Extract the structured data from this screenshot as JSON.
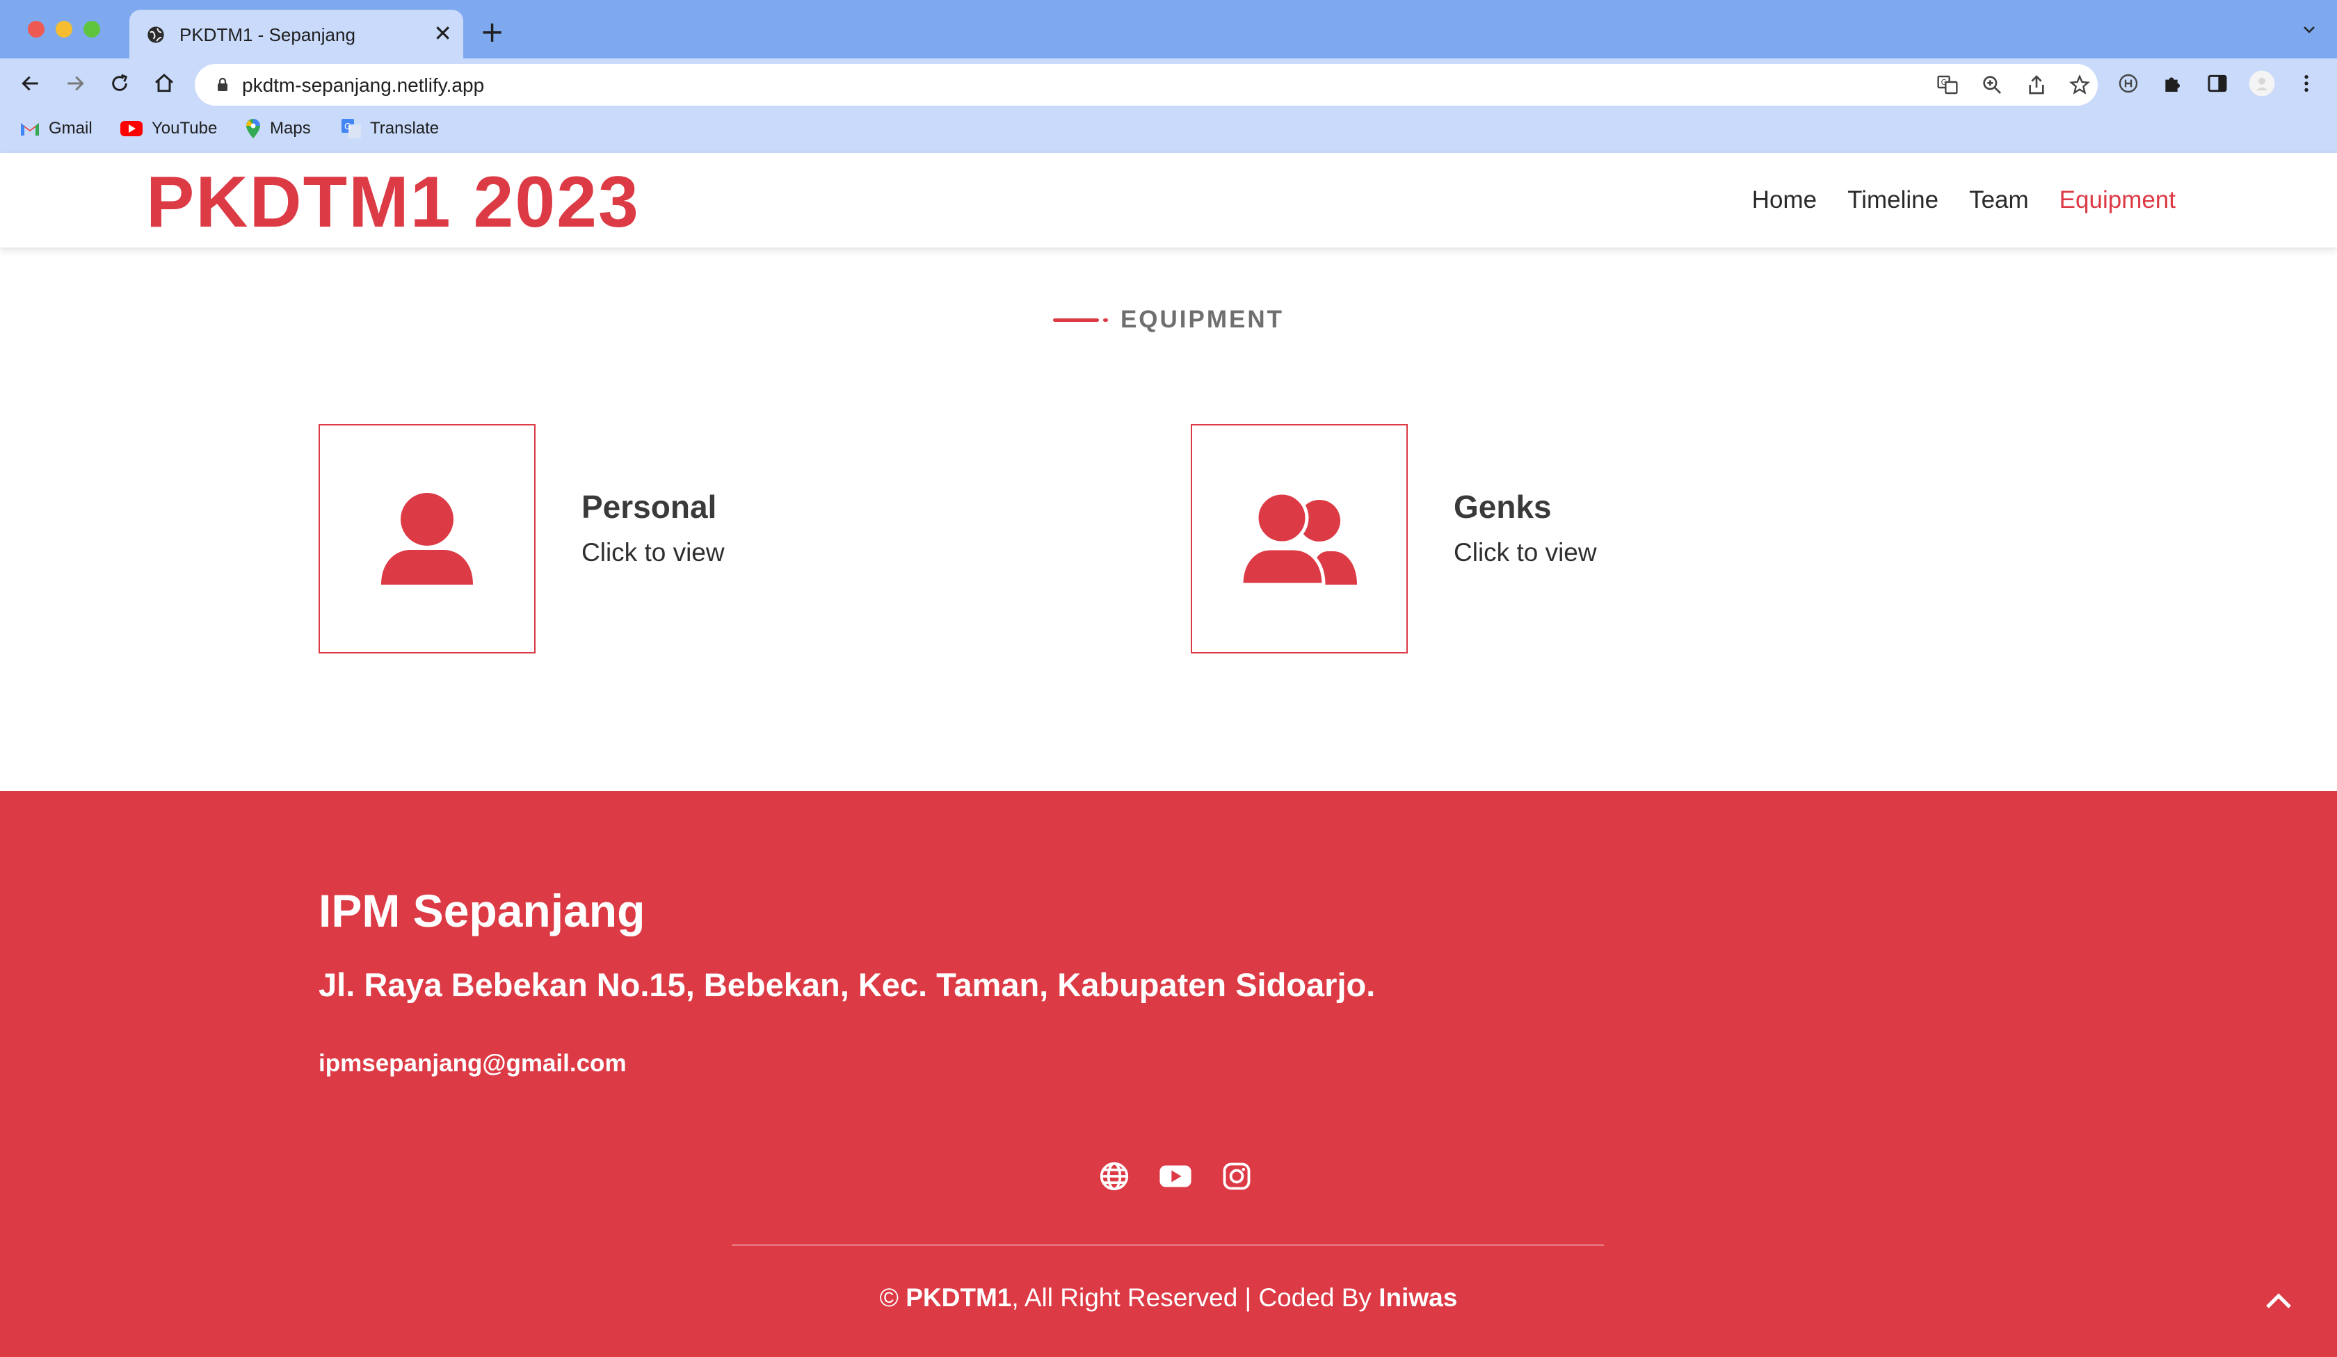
{
  "browser": {
    "tab_title": "PKDTM1 - Sepanjang",
    "tab_close": "✕",
    "new_tab": "+",
    "url": "pkdtm-sepanjang.netlify.app",
    "bookmarks": [
      {
        "label": "Gmail",
        "icon": "gmail-icon"
      },
      {
        "label": "YouTube",
        "icon": "youtube-icon"
      },
      {
        "label": "Maps",
        "icon": "maps-icon"
      },
      {
        "label": "Translate",
        "icon": "translate-icon"
      }
    ]
  },
  "site": {
    "brand": "PKDTM1 2023",
    "nav": [
      {
        "label": "Home",
        "active": false
      },
      {
        "label": "Timeline",
        "active": false
      },
      {
        "label": "Team",
        "active": false
      },
      {
        "label": "Equipment",
        "active": true
      }
    ],
    "accent_color": "#dc3a45"
  },
  "section": {
    "label": "EQUIPMENT",
    "cards": [
      {
        "title": "Personal",
        "subtitle": "Click to view",
        "icon": "user-icon"
      },
      {
        "title": "Genks",
        "subtitle": "Click to view",
        "icon": "users-icon"
      }
    ]
  },
  "footer": {
    "title": "IPM Sepanjang",
    "address": "Jl. Raya Bebekan No.15, Bebekan, Kec. Taman, Kabupaten Sidoarjo.",
    "email": "ipmsepanjang@gmail.com",
    "socials": [
      "globe-icon",
      "youtube-icon",
      "instagram-icon"
    ],
    "copyright_prefix": "© ",
    "copyright_brand": "PKDTM1",
    "copyright_middle": ", All Right Reserved | Coded By ",
    "copyright_author": "Iniwas"
  }
}
